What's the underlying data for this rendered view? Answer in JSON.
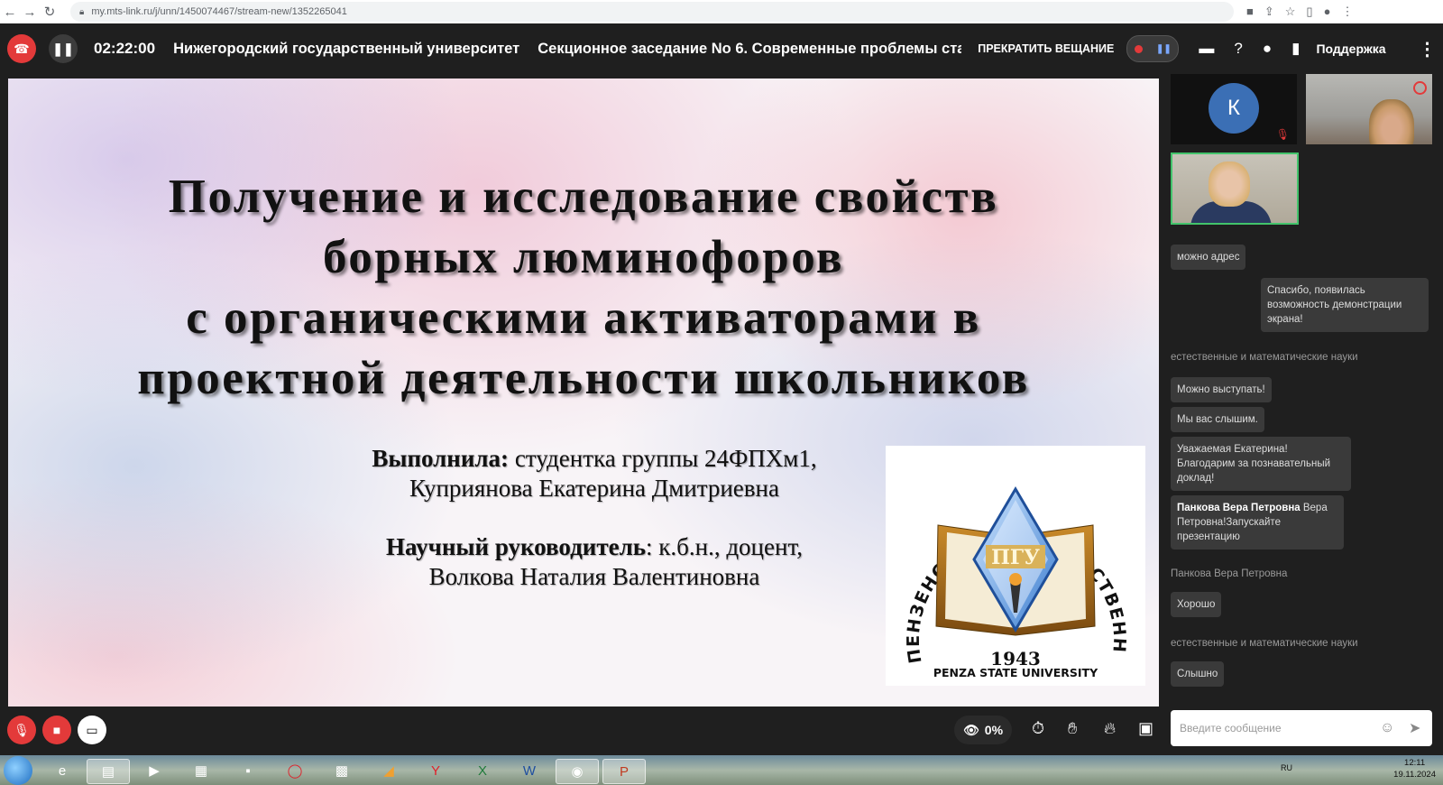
{
  "browser": {
    "url": "my.mts-link.ru/j/unn/1450074467/stream-new/1352265041"
  },
  "topbar": {
    "timer": "02:22:00",
    "title": "Нижегородский государственный университет",
    "session": "Секционное заседание No 6. Современные проблемы ста",
    "stop_broadcast": "ПРЕКРАТИТЬ ВЕЩАНИЕ",
    "support": "Поддержка"
  },
  "slide": {
    "title_lines": [
      "Получение и исследование свойств",
      "борных люминофоров",
      "с органическими активаторами в",
      "проектной деятельности школьников"
    ],
    "author_label": "Выполнила:",
    "author_text": "студентка группы 24ФПХм1,",
    "author_name": "Куприянова Екатерина Дмитриевна",
    "advisor_label": "Научный руководитель",
    "advisor_text": ": к.б.н., доцент,",
    "advisor_name": "Волкова Наталия Валентиновна",
    "logo": {
      "arc_text": "ПЕНЗЕНСКИЙ ГОСУДАРСТВЕННЫЙ УНИВЕРСИТЕТ",
      "abbr": "ПГУ",
      "year": "1943",
      "english": "PENZA STATE UNIVERSITY"
    }
  },
  "participants": {
    "k_initial": "К"
  },
  "chat": {
    "messages": [
      {
        "text": "можно адрес"
      },
      {
        "text": "Спасибо, появилась возможность демонстрации экрана!"
      },
      {
        "sender": "естественные и математические науки"
      },
      {
        "text": "Можно выступать!"
      },
      {
        "text": "Мы вас слышим."
      },
      {
        "text": "Уважаемая Екатерина! Благодарим за познавательный доклад!"
      },
      {
        "bold": "Панкова Вера Петровна",
        "text": " Вера Петровна!Запускайте презентацию"
      },
      {
        "sender": "Панкова Вера Петровна"
      },
      {
        "text": "Хорошо"
      },
      {
        "sender": "естественные и математические науки"
      },
      {
        "text": "Слышно"
      }
    ],
    "placeholder": "Введите сообщение"
  },
  "bottombar": {
    "views_percent": "0%"
  },
  "taskbar": {
    "lang": "RU",
    "time": "12:11",
    "date": "19.11.2024"
  },
  "colors": {
    "hangup": "#e33a3a",
    "accent_green": "#42c36b",
    "avatar_blue": "#3b6fb5"
  }
}
